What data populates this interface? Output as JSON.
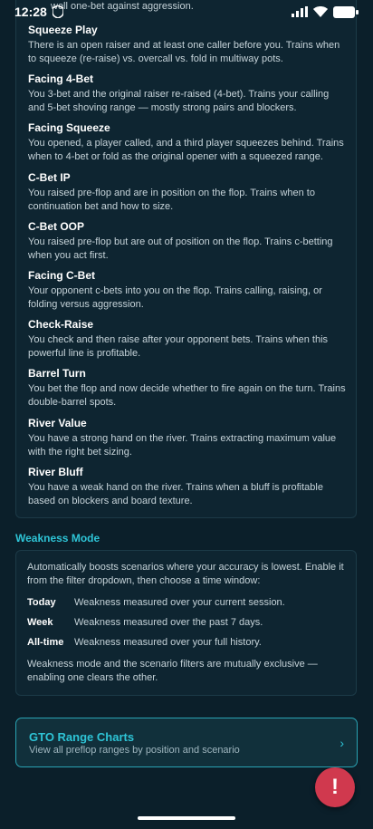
{
  "status_bar": {
    "time": "12:28"
  },
  "partial_top": "well one-bet against aggression.",
  "scenarios": [
    {
      "title": "Squeeze Play",
      "desc": "There is an open raiser and at least one caller before you. Trains when to squeeze (re-raise) vs. overcall vs. fold in multiway pots."
    },
    {
      "title": "Facing 4-Bet",
      "desc": "You 3-bet and the original raiser re-raised (4-bet). Trains your calling and 5-bet shoving range — mostly strong pairs and blockers."
    },
    {
      "title": "Facing Squeeze",
      "desc": "You opened, a player called, and a third player squeezes behind. Trains when to 4-bet or fold as the original opener with a squeezed range."
    },
    {
      "title": "C-Bet IP",
      "desc": "You raised pre-flop and are in position on the flop. Trains when to continuation bet and how to size."
    },
    {
      "title": "C-Bet OOP",
      "desc": "You raised pre-flop but are out of position on the flop. Trains c-betting when you act first."
    },
    {
      "title": "Facing C-Bet",
      "desc": "Your opponent c-bets into you on the flop. Trains calling, raising, or folding versus aggression."
    },
    {
      "title": "Check-Raise",
      "desc": "You check and then raise after your opponent bets. Trains when this powerful line is profitable."
    },
    {
      "title": "Barrel Turn",
      "desc": "You bet the flop and now decide whether to fire again on the turn. Trains double-barrel spots."
    },
    {
      "title": "River Value",
      "desc": "You have a strong hand on the river. Trains extracting maximum value with the right bet sizing."
    },
    {
      "title": "River Bluff",
      "desc": "You have a weak hand on the river. Trains when a bluff is profitable based on blockers and board texture."
    }
  ],
  "weakness": {
    "heading": "Weakness Mode",
    "intro": "Automatically boosts scenarios where your accuracy is lowest. Enable it from the filter dropdown, then choose a time window:",
    "rows": [
      {
        "term": "Today",
        "def": "Weakness measured over your current session."
      },
      {
        "term": "Week",
        "def": "Weakness measured over the past 7 days."
      },
      {
        "term": "All-time",
        "def": "Weakness measured over your full history."
      }
    ],
    "footer": "Weakness mode and the scenario filters are mutually exclusive — enabling one clears the other."
  },
  "gto": {
    "title": "GTO Range Charts",
    "subtitle": "View all preflop ranges by position and scenario",
    "chevron": "›"
  },
  "fab_glyph": "!"
}
